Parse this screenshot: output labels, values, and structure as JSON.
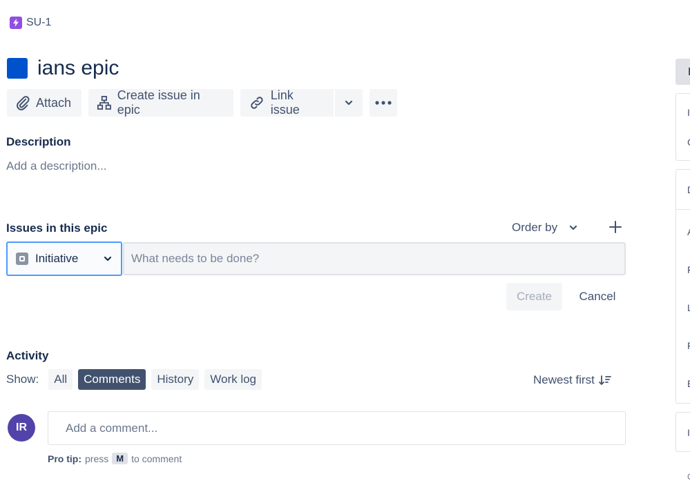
{
  "breadcrumb": {
    "key": "SU-1"
  },
  "issue": {
    "title": "ians epic"
  },
  "toolbar": {
    "attach": "Attach",
    "create_issue_in_epic": "Create issue in epic",
    "link_issue": "Link issue"
  },
  "description": {
    "label": "Description",
    "placeholder": "Add a description..."
  },
  "epic_issues": {
    "label": "Issues in this epic",
    "order_by": "Order by",
    "issue_type": "Initiative",
    "summary_placeholder": "What needs to be done?",
    "create": "Create",
    "cancel": "Cancel"
  },
  "activity": {
    "label": "Activity",
    "show": "Show:",
    "filters": [
      "All",
      "Comments",
      "History",
      "Work log"
    ],
    "active_filter": "Comments",
    "sort": "Newest first",
    "avatar_initials": "IR",
    "comment_placeholder": "Add a comment...",
    "pro_tip_label": "Pro tip:",
    "pro_tip_press": "press",
    "pro_tip_key": "M",
    "pro_tip_suffix": "to comment"
  },
  "sidebar_fragments": {
    "tab_letter": "E",
    "letters": [
      "I",
      "C",
      "D",
      "A",
      "F",
      "L",
      "F",
      "E",
      "I",
      "C"
    ]
  },
  "colors": {
    "epic": "#0052cc",
    "crumb_icon": "#904ee2",
    "avatar": "#5243aa",
    "focus_border": "#4c9aff",
    "active_pill": "#42526e"
  }
}
